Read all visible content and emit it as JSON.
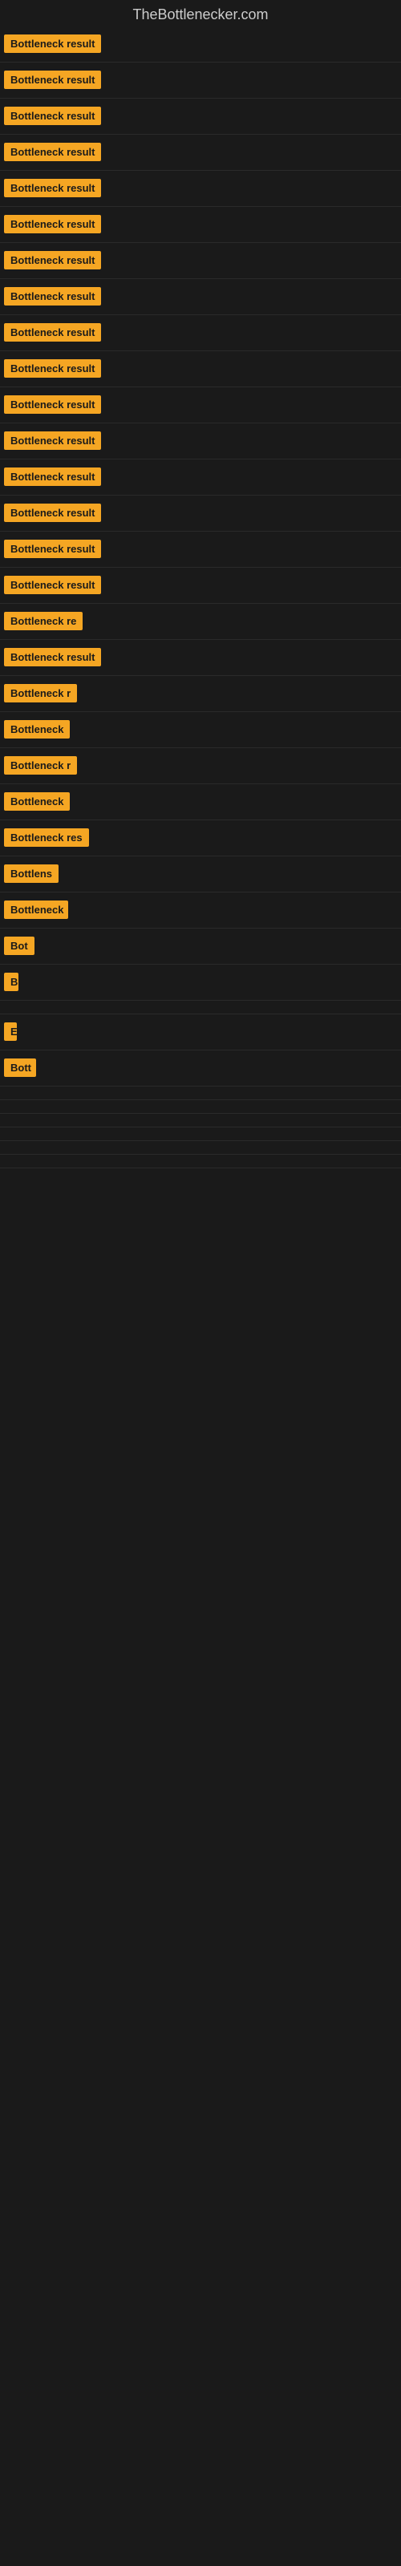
{
  "site": {
    "title": "TheBottlenecker.com"
  },
  "rows": [
    {
      "label": "Bottleneck result",
      "width": 145
    },
    {
      "label": "Bottleneck result",
      "width": 145
    },
    {
      "label": "Bottleneck result",
      "width": 145
    },
    {
      "label": "Bottleneck result",
      "width": 145
    },
    {
      "label": "Bottleneck result",
      "width": 145
    },
    {
      "label": "Bottleneck result",
      "width": 145
    },
    {
      "label": "Bottleneck result",
      "width": 145
    },
    {
      "label": "Bottleneck result",
      "width": 145
    },
    {
      "label": "Bottleneck result",
      "width": 145
    },
    {
      "label": "Bottleneck result",
      "width": 145
    },
    {
      "label": "Bottleneck result",
      "width": 145
    },
    {
      "label": "Bottleneck result",
      "width": 145
    },
    {
      "label": "Bottleneck result",
      "width": 145
    },
    {
      "label": "Bottleneck result",
      "width": 145
    },
    {
      "label": "Bottleneck result",
      "width": 140
    },
    {
      "label": "Bottleneck result",
      "width": 135
    },
    {
      "label": "Bottleneck re",
      "width": 110
    },
    {
      "label": "Bottleneck result",
      "width": 128
    },
    {
      "label": "Bottleneck r",
      "width": 100
    },
    {
      "label": "Bottleneck",
      "width": 85
    },
    {
      "label": "Bottleneck r",
      "width": 95
    },
    {
      "label": "Bottleneck",
      "width": 82
    },
    {
      "label": "Bottleneck res",
      "width": 108
    },
    {
      "label": "Bottlens",
      "width": 70
    },
    {
      "label": "Bottleneck",
      "width": 80
    },
    {
      "label": "Bot",
      "width": 38
    },
    {
      "label": "B",
      "width": 18
    },
    {
      "label": "",
      "width": 0
    },
    {
      "label": "E",
      "width": 14
    },
    {
      "label": "Bott",
      "width": 40
    },
    {
      "label": "",
      "width": 0
    },
    {
      "label": "",
      "width": 0
    },
    {
      "label": "",
      "width": 0
    },
    {
      "label": "",
      "width": 0
    },
    {
      "label": "",
      "width": 0
    },
    {
      "label": "",
      "width": 0
    }
  ]
}
